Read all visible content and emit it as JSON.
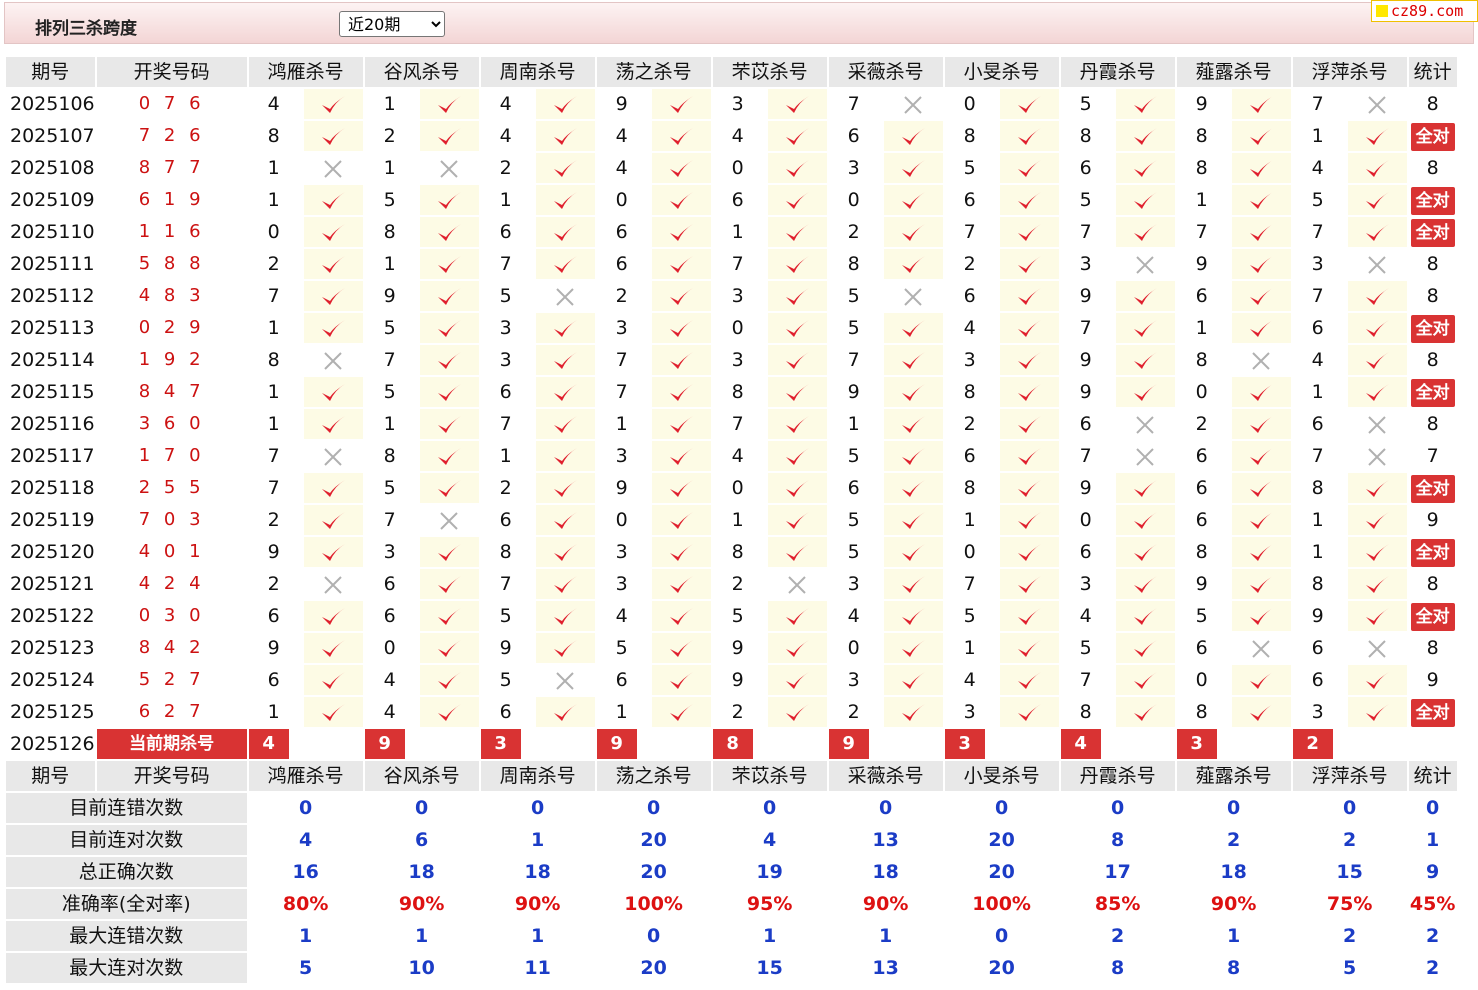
{
  "header": {
    "title": "排列三杀跨度",
    "period_select": "近20期",
    "site_badge": "cz89.com"
  },
  "columns": {
    "issue": "期号",
    "draw": "开奖号码",
    "experts": [
      "鸿雁杀号",
      "谷风杀号",
      "周南杀号",
      "荡之杀号",
      "芣苡杀号",
      "采薇杀号",
      "小旻杀号",
      "丹霞杀号",
      "薤露杀号",
      "浮萍杀号"
    ],
    "total": "统计"
  },
  "rows": [
    {
      "issue": "2025106",
      "draw": "0 7 6",
      "picks": [
        [
          4,
          1
        ],
        [
          1,
          1
        ],
        [
          4,
          1
        ],
        [
          9,
          1
        ],
        [
          3,
          1
        ],
        [
          7,
          0
        ],
        [
          0,
          1
        ],
        [
          5,
          1
        ],
        [
          9,
          1
        ],
        [
          7,
          0
        ]
      ],
      "total": "8"
    },
    {
      "issue": "2025107",
      "draw": "7 2 6",
      "picks": [
        [
          8,
          1
        ],
        [
          2,
          1
        ],
        [
          4,
          1
        ],
        [
          4,
          1
        ],
        [
          4,
          1
        ],
        [
          6,
          1
        ],
        [
          8,
          1
        ],
        [
          8,
          1
        ],
        [
          8,
          1
        ],
        [
          1,
          1
        ]
      ],
      "total": "全对"
    },
    {
      "issue": "2025108",
      "draw": "8 7 7",
      "picks": [
        [
          1,
          0
        ],
        [
          1,
          0
        ],
        [
          2,
          1
        ],
        [
          4,
          1
        ],
        [
          0,
          1
        ],
        [
          3,
          1
        ],
        [
          5,
          1
        ],
        [
          6,
          1
        ],
        [
          8,
          1
        ],
        [
          4,
          1
        ]
      ],
      "total": "8"
    },
    {
      "issue": "2025109",
      "draw": "6 1 9",
      "picks": [
        [
          1,
          1
        ],
        [
          5,
          1
        ],
        [
          1,
          1
        ],
        [
          0,
          1
        ],
        [
          6,
          1
        ],
        [
          0,
          1
        ],
        [
          6,
          1
        ],
        [
          5,
          1
        ],
        [
          1,
          1
        ],
        [
          5,
          1
        ]
      ],
      "total": "全对"
    },
    {
      "issue": "2025110",
      "draw": "1 1 6",
      "picks": [
        [
          0,
          1
        ],
        [
          8,
          1
        ],
        [
          6,
          1
        ],
        [
          6,
          1
        ],
        [
          1,
          1
        ],
        [
          2,
          1
        ],
        [
          7,
          1
        ],
        [
          7,
          1
        ],
        [
          7,
          1
        ],
        [
          7,
          1
        ]
      ],
      "total": "全对"
    },
    {
      "issue": "2025111",
      "draw": "5 8 8",
      "picks": [
        [
          2,
          1
        ],
        [
          1,
          1
        ],
        [
          7,
          1
        ],
        [
          6,
          1
        ],
        [
          7,
          1
        ],
        [
          8,
          1
        ],
        [
          2,
          1
        ],
        [
          3,
          0
        ],
        [
          9,
          1
        ],
        [
          3,
          0
        ]
      ],
      "total": "8"
    },
    {
      "issue": "2025112",
      "draw": "4 8 3",
      "picks": [
        [
          7,
          1
        ],
        [
          9,
          1
        ],
        [
          5,
          0
        ],
        [
          2,
          1
        ],
        [
          3,
          1
        ],
        [
          5,
          0
        ],
        [
          6,
          1
        ],
        [
          9,
          1
        ],
        [
          6,
          1
        ],
        [
          7,
          1
        ]
      ],
      "total": "8"
    },
    {
      "issue": "2025113",
      "draw": "0 2 9",
      "picks": [
        [
          1,
          1
        ],
        [
          5,
          1
        ],
        [
          3,
          1
        ],
        [
          3,
          1
        ],
        [
          0,
          1
        ],
        [
          5,
          1
        ],
        [
          4,
          1
        ],
        [
          7,
          1
        ],
        [
          1,
          1
        ],
        [
          6,
          1
        ]
      ],
      "total": "全对"
    },
    {
      "issue": "2025114",
      "draw": "1 9 2",
      "picks": [
        [
          8,
          0
        ],
        [
          7,
          1
        ],
        [
          3,
          1
        ],
        [
          7,
          1
        ],
        [
          3,
          1
        ],
        [
          7,
          1
        ],
        [
          3,
          1
        ],
        [
          9,
          1
        ],
        [
          8,
          0
        ],
        [
          4,
          1
        ]
      ],
      "total": "8"
    },
    {
      "issue": "2025115",
      "draw": "8 4 7",
      "picks": [
        [
          1,
          1
        ],
        [
          5,
          1
        ],
        [
          6,
          1
        ],
        [
          7,
          1
        ],
        [
          8,
          1
        ],
        [
          9,
          1
        ],
        [
          8,
          1
        ],
        [
          9,
          1
        ],
        [
          0,
          1
        ],
        [
          1,
          1
        ]
      ],
      "total": "全对"
    },
    {
      "issue": "2025116",
      "draw": "3 6 0",
      "picks": [
        [
          1,
          1
        ],
        [
          1,
          1
        ],
        [
          7,
          1
        ],
        [
          1,
          1
        ],
        [
          7,
          1
        ],
        [
          1,
          1
        ],
        [
          2,
          1
        ],
        [
          6,
          0
        ],
        [
          2,
          1
        ],
        [
          6,
          0
        ]
      ],
      "total": "8"
    },
    {
      "issue": "2025117",
      "draw": "1 7 0",
      "picks": [
        [
          7,
          0
        ],
        [
          8,
          1
        ],
        [
          1,
          1
        ],
        [
          3,
          1
        ],
        [
          4,
          1
        ],
        [
          5,
          1
        ],
        [
          6,
          1
        ],
        [
          7,
          0
        ],
        [
          6,
          1
        ],
        [
          7,
          0
        ]
      ],
      "total": "7"
    },
    {
      "issue": "2025118",
      "draw": "2 5 5",
      "picks": [
        [
          7,
          1
        ],
        [
          5,
          1
        ],
        [
          2,
          1
        ],
        [
          9,
          1
        ],
        [
          0,
          1
        ],
        [
          6,
          1
        ],
        [
          8,
          1
        ],
        [
          9,
          1
        ],
        [
          6,
          1
        ],
        [
          8,
          1
        ]
      ],
      "total": "全对"
    },
    {
      "issue": "2025119",
      "draw": "7 0 3",
      "picks": [
        [
          2,
          1
        ],
        [
          7,
          0
        ],
        [
          6,
          1
        ],
        [
          0,
          1
        ],
        [
          1,
          1
        ],
        [
          5,
          1
        ],
        [
          1,
          1
        ],
        [
          0,
          1
        ],
        [
          6,
          1
        ],
        [
          1,
          1
        ]
      ],
      "total": "9"
    },
    {
      "issue": "2025120",
      "draw": "4 0 1",
      "picks": [
        [
          9,
          1
        ],
        [
          3,
          1
        ],
        [
          8,
          1
        ],
        [
          3,
          1
        ],
        [
          8,
          1
        ],
        [
          5,
          1
        ],
        [
          0,
          1
        ],
        [
          6,
          1
        ],
        [
          8,
          1
        ],
        [
          1,
          1
        ]
      ],
      "total": "全对"
    },
    {
      "issue": "2025121",
      "draw": "4 2 4",
      "picks": [
        [
          2,
          0
        ],
        [
          6,
          1
        ],
        [
          7,
          1
        ],
        [
          3,
          1
        ],
        [
          2,
          0
        ],
        [
          3,
          1
        ],
        [
          7,
          1
        ],
        [
          3,
          1
        ],
        [
          9,
          1
        ],
        [
          8,
          1
        ]
      ],
      "total": "8"
    },
    {
      "issue": "2025122",
      "draw": "0 3 0",
      "picks": [
        [
          6,
          1
        ],
        [
          6,
          1
        ],
        [
          5,
          1
        ],
        [
          4,
          1
        ],
        [
          5,
          1
        ],
        [
          4,
          1
        ],
        [
          5,
          1
        ],
        [
          4,
          1
        ],
        [
          5,
          1
        ],
        [
          9,
          1
        ]
      ],
      "total": "全对"
    },
    {
      "issue": "2025123",
      "draw": "8 4 2",
      "picks": [
        [
          9,
          1
        ],
        [
          0,
          1
        ],
        [
          9,
          1
        ],
        [
          5,
          1
        ],
        [
          9,
          1
        ],
        [
          0,
          1
        ],
        [
          1,
          1
        ],
        [
          5,
          1
        ],
        [
          6,
          0
        ],
        [
          6,
          0
        ]
      ],
      "total": "8"
    },
    {
      "issue": "2025124",
      "draw": "5 2 7",
      "picks": [
        [
          6,
          1
        ],
        [
          4,
          1
        ],
        [
          5,
          0
        ],
        [
          6,
          1
        ],
        [
          9,
          1
        ],
        [
          3,
          1
        ],
        [
          4,
          1
        ],
        [
          7,
          1
        ],
        [
          0,
          1
        ],
        [
          6,
          1
        ]
      ],
      "total": "9"
    },
    {
      "issue": "2025125",
      "draw": "6 2 7",
      "picks": [
        [
          1,
          1
        ],
        [
          4,
          1
        ],
        [
          6,
          1
        ],
        [
          1,
          1
        ],
        [
          2,
          1
        ],
        [
          2,
          1
        ],
        [
          3,
          1
        ],
        [
          8,
          1
        ],
        [
          8,
          1
        ],
        [
          3,
          1
        ]
      ],
      "total": "全对"
    }
  ],
  "current": {
    "issue": "2025126",
    "label": "当前期杀号",
    "picks": [
      "4",
      "9",
      "3",
      "9",
      "8",
      "9",
      "3",
      "4",
      "3",
      "2"
    ]
  },
  "stats": [
    {
      "label": "目前连错次数",
      "values": [
        "0",
        "0",
        "0",
        "0",
        "0",
        "0",
        "0",
        "0",
        "0",
        "0",
        "0"
      ],
      "highlight": false
    },
    {
      "label": "目前连对次数",
      "values": [
        "4",
        "6",
        "1",
        "20",
        "4",
        "13",
        "20",
        "8",
        "2",
        "2",
        "1"
      ],
      "highlight": false
    },
    {
      "label": "总正确次数",
      "values": [
        "16",
        "18",
        "18",
        "20",
        "19",
        "18",
        "20",
        "17",
        "18",
        "15",
        "9"
      ],
      "highlight": false
    },
    {
      "label": "准确率(全对率)",
      "values": [
        "80%",
        "90%",
        "90%",
        "100%",
        "95%",
        "90%",
        "100%",
        "85%",
        "90%",
        "75%",
        "45%"
      ],
      "highlight": true
    },
    {
      "label": "最大连错次数",
      "values": [
        "1",
        "1",
        "1",
        "0",
        "1",
        "1",
        "0",
        "2",
        "1",
        "2",
        "2"
      ],
      "highlight": false
    },
    {
      "label": "最大连对次数",
      "values": [
        "5",
        "10",
        "11",
        "20",
        "15",
        "13",
        "20",
        "8",
        "8",
        "5",
        "2"
      ],
      "highlight": false
    }
  ],
  "colors": {
    "check": "#e0202e",
    "cross": "#b0b0b0",
    "accent_red": "#d93333",
    "stat_blue": "#1b3cc6"
  },
  "icons": {
    "correct": "check-icon",
    "wrong": "cross-icon"
  }
}
